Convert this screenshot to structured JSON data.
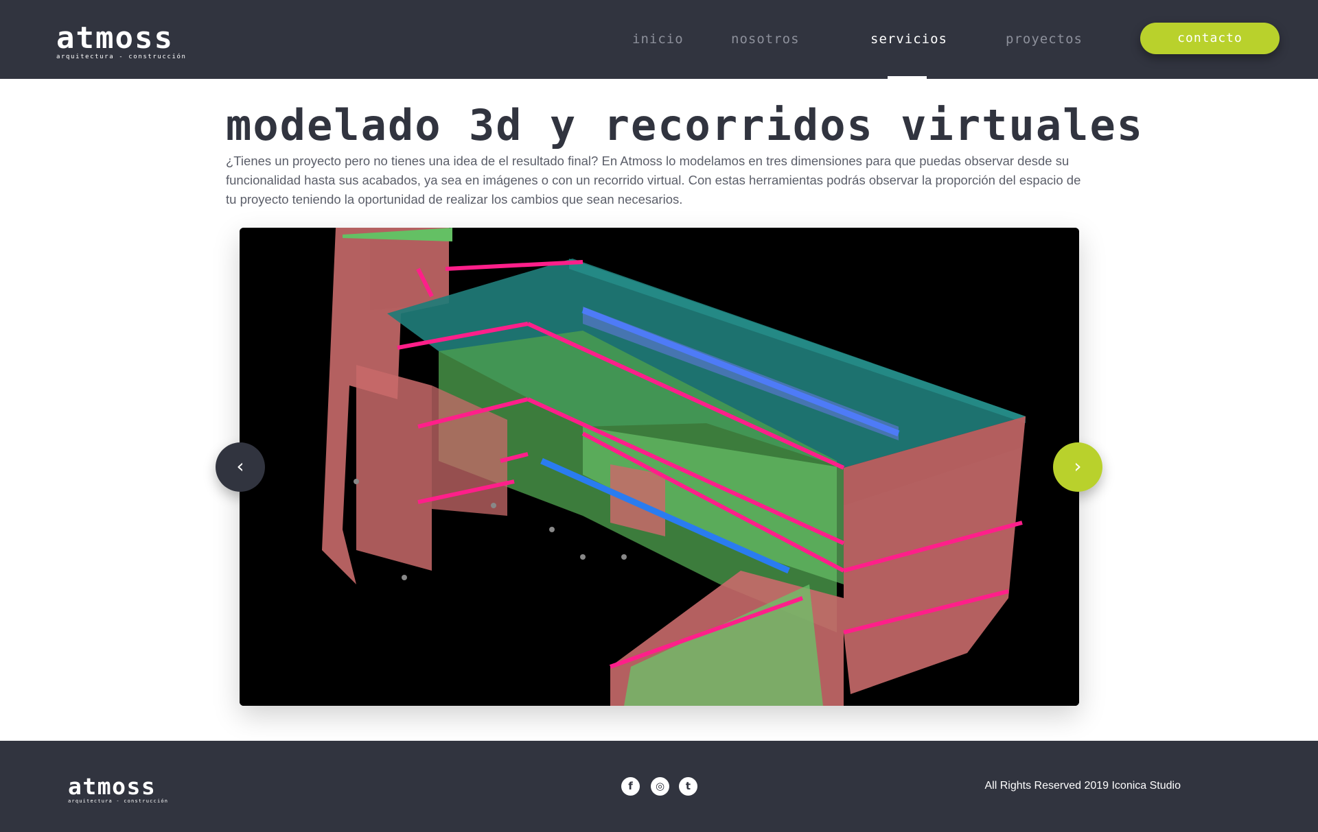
{
  "header": {
    "logo": {
      "name": "atmoss",
      "tagline": "arquitectura - construcción"
    },
    "nav": [
      {
        "label": "inicio",
        "active": false
      },
      {
        "label": "nosotros",
        "active": false
      },
      {
        "label": "servicios",
        "active": true
      },
      {
        "label": "proyectos",
        "active": false
      }
    ],
    "contact_label": "contacto"
  },
  "main": {
    "title": "modelado 3d y recorridos virtuales",
    "description": "¿Tienes un proyecto pero no tienes una idea de el resultado final? En Atmoss lo modelamos  en tres dimensiones para que puedas observar desde su funcionalidad hasta sus acabados, ya sea en imágenes o con un recorrido virtual. Con estas herramientas podrás observar  la proporción del espacio de tu proyecto teniendo la oportunidad de realizar los cambios que sean necesarios.",
    "slider": {
      "image": "3d-structural-model",
      "prev_icon": "chevron-left-icon",
      "next_icon": "chevron-right-icon",
      "prev_glyph": "‹",
      "next_glyph": "›"
    }
  },
  "footer": {
    "logo": {
      "name": "atmoss",
      "tagline": "arquitectura - construcción"
    },
    "social": [
      {
        "icon": "facebook-icon",
        "glyph": "f"
      },
      {
        "icon": "instagram-icon",
        "glyph": "◎"
      },
      {
        "icon": "twitter-icon",
        "glyph": "t"
      }
    ],
    "copyright": "All Rights Reserved 2019 Iconica Studio"
  },
  "colors": {
    "dark": "#31343f",
    "accent": "#b9d12c",
    "white": "#ffffff"
  }
}
